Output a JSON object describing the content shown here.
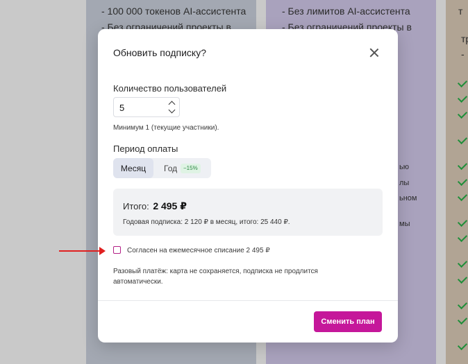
{
  "background": {
    "card_a_lines": [
      "- 100 000 токенов AI-ассистента",
      "- Без ограничений проекты в"
    ],
    "card_b_lines": [
      "- Без лимитов AI-ассистента",
      "- Без ограничений проекты в"
    ],
    "card_b_fragments": [
      "ью",
      "лы",
      "ьном",
      "мы"
    ],
    "card_c_fragments": [
      "т",
      "тр",
      "-"
    ]
  },
  "modal": {
    "title": "Обновить подписку?",
    "quantity_label": "Количество пользователей",
    "quantity_value": "5",
    "quantity_hint": "Минимум 1 (текущие участники).",
    "period_label": "Период оплаты",
    "period_month": "Месяц",
    "period_year": "Год",
    "period_discount": "−15%",
    "total_label": "Итого:",
    "total_amount": "2 495 ₽",
    "yearly_text": "Годовая подписка: 2 120 ₽ в месяц, итого: 25 440 ₽.",
    "agree_label": "Согласен на ежемесячное списание 2 495 ₽",
    "note": "Разовый платёж: карта не сохраняется, подписка не продлится автоматически.",
    "submit_label": "Сменить план"
  },
  "colors": {
    "accent": "#c5179a",
    "checkbox_border": "#b31f86",
    "arrow": "#e02020",
    "discount_bg": "#dff3e4",
    "discount_text": "#2c8a44"
  }
}
